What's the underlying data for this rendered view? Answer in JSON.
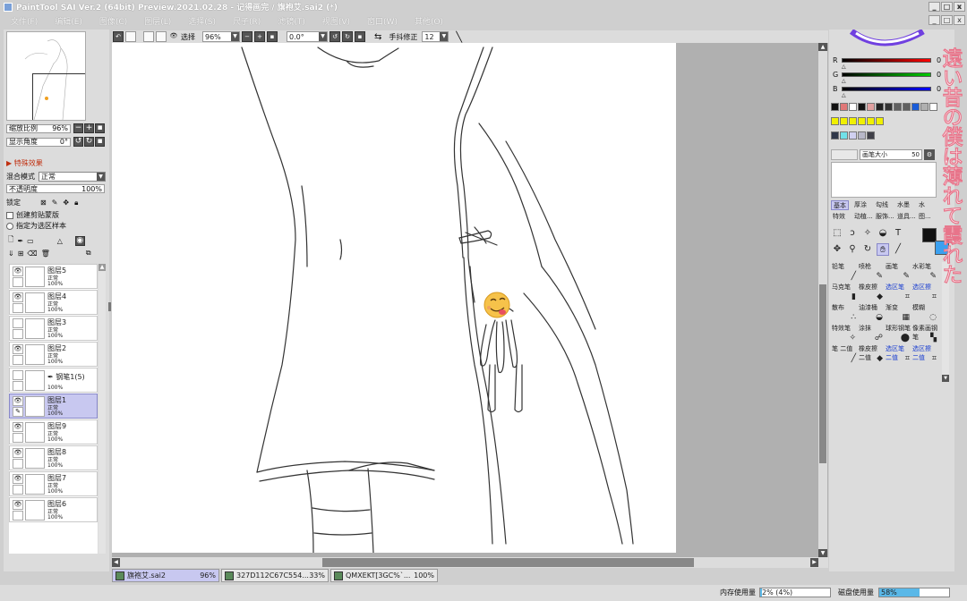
{
  "title": "PaintTool SAI Ver.2 (64bit) Preview.2021.02.28 - 记得画完 / 旗袍艾.sai2 (*)",
  "window_buttons": [
    "_",
    "□",
    "x"
  ],
  "doc_buttons": [
    "_",
    "□",
    "x"
  ],
  "menu": [
    "文件(F)",
    "编辑(E)",
    "图像(C)",
    "图层(L)",
    "选择(S)",
    "尺子(R)",
    "滤镜(T)",
    "视图(V)",
    "窗口(W)",
    "其他(O)"
  ],
  "navigator": {
    "zoom_label": "缩放比例",
    "zoom_value": "96%",
    "angle_label": "显示角度",
    "angle_value": "0°"
  },
  "effects_label": "特殊效果",
  "blend_label": "混合模式",
  "blend_value": "正常",
  "opacity_label": "不透明度",
  "opacity_value": "100%",
  "lock_label": "锁定",
  "clip_label": "创建剪贴蒙版",
  "sample_label": "指定为选区样本",
  "layers": [
    {
      "name": "图层5",
      "mode": "正常",
      "opacity": "100%",
      "visible": true,
      "selected": false
    },
    {
      "name": "图层4",
      "mode": "正常",
      "opacity": "100%",
      "visible": true,
      "selected": false
    },
    {
      "name": "图层3",
      "mode": "正常",
      "opacity": "100%",
      "visible": false,
      "selected": false
    },
    {
      "name": "图层2",
      "mode": "正常",
      "opacity": "100%",
      "visible": true,
      "selected": false
    },
    {
      "name": "钢笔1(5)",
      "mode": "",
      "opacity": "100%",
      "visible": false,
      "selected": false
    },
    {
      "name": "图层1",
      "mode": "正常",
      "opacity": "100%",
      "visible": true,
      "selected": true
    },
    {
      "name": "图层9",
      "mode": "正常",
      "opacity": "100%",
      "visible": true,
      "selected": false
    },
    {
      "name": "图层8",
      "mode": "正常",
      "opacity": "100%",
      "visible": true,
      "selected": false
    },
    {
      "name": "图层7",
      "mode": "正常",
      "opacity": "100%",
      "visible": true,
      "selected": false
    },
    {
      "name": "图层6",
      "mode": "正常",
      "opacity": "100%",
      "visible": true,
      "selected": false
    }
  ],
  "toolbar": {
    "select_label": "选择",
    "zoom_value": "96%",
    "angle_value": "0.0°",
    "stabilizer_label": "手抖修正",
    "stabilizer_value": "12"
  },
  "tabs": [
    {
      "name": "旗袍艾.sai2",
      "zoom": "96%",
      "active": true
    },
    {
      "name": "327D112C67C554...",
      "zoom": "33%",
      "active": false
    },
    {
      "name": "QMXEKT[3GC%`...",
      "zoom": "100%",
      "active": false
    }
  ],
  "status": {
    "memory_label": "内存使用量",
    "memory_value": "2% (4%)",
    "memory_fraction": 0.02,
    "disk_label": "磁盘使用量",
    "disk_value": "58%",
    "disk_fraction": 0.58
  },
  "color": {
    "r_label": "R",
    "r_value": "0",
    "g_label": "G",
    "g_value": "0",
    "b_label": "B",
    "b_value": "0",
    "swatches": [
      "#111111",
      "#e07878",
      "#ffffff",
      "#111111",
      "#e0a0a0",
      "#222222",
      "#333333",
      "#606060",
      "#606060",
      "#1a5cd8",
      "#b0b0b0",
      "#ffffff",
      "#f0f000",
      "#f0f000",
      "#f0f000",
      "#f0f000",
      "#f0f000",
      "#f0f000",
      "#30384a",
      "#70e0e8",
      "#d0d0f0",
      "#b8b8c8",
      "#404048"
    ]
  },
  "brush_size_label": "画笔大小",
  "brush_size_value": "50",
  "brush_categories": [
    "基本",
    "厚涂",
    "勾线",
    "水墨",
    "水",
    "特效",
    "动植...",
    "服饰...",
    "道具...",
    "图..."
  ],
  "brush_tools": [
    {
      "name": "铅笔",
      "blue": false
    },
    {
      "name": "喷枪",
      "blue": false
    },
    {
      "name": "画笔",
      "blue": false
    },
    {
      "name": "水彩笔",
      "blue": false
    },
    {
      "name": "马克笔",
      "blue": false
    },
    {
      "name": "橡皮擦",
      "blue": false
    },
    {
      "name": "选区笔",
      "blue": true
    },
    {
      "name": "选区擦",
      "blue": true
    },
    {
      "name": "散布",
      "blue": false
    },
    {
      "name": "油漆桶",
      "blue": false
    },
    {
      "name": "渐变",
      "blue": false
    },
    {
      "name": "模糊",
      "blue": false
    },
    {
      "name": "特效笔",
      "blue": false
    },
    {
      "name": "涂抹",
      "blue": false
    },
    {
      "name": "球形钢笔",
      "blue": false
    },
    {
      "name": "像素画钢笔",
      "blue": false
    },
    {
      "name": "笔 二值",
      "blue": false
    },
    {
      "name": "橡皮擦 二值",
      "blue": false
    },
    {
      "name": "选区笔 二值",
      "blue": true
    },
    {
      "name": "选区擦 二值",
      "blue": true
    }
  ],
  "tool_icons": [
    "marquee-icon",
    "lasso-icon",
    "magic-wand-icon",
    "bucket-icon",
    "text-icon",
    "move-icon",
    "zoom-icon",
    "rotate-icon",
    "hand-icon",
    "eyedropper-icon"
  ],
  "overlay_text": "遠い昔の僕は薄れて霞れた"
}
